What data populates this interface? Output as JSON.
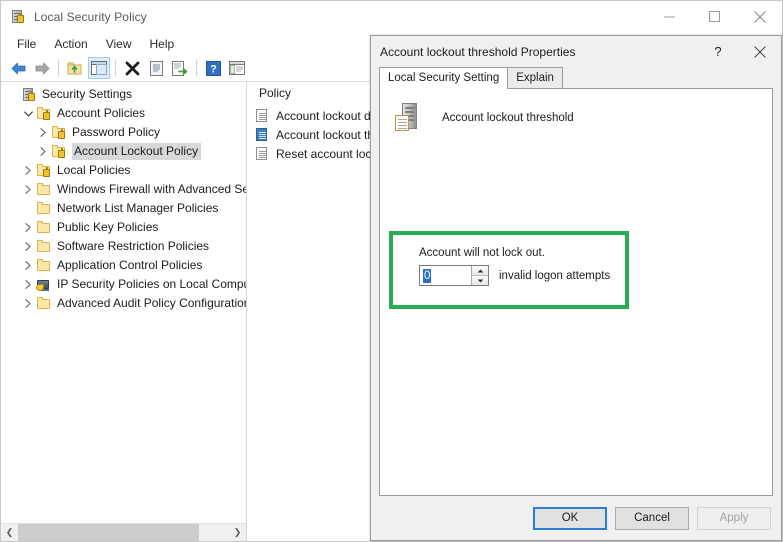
{
  "window": {
    "title": "Local Security Policy",
    "icon": "security-policy-icon",
    "controls": {
      "minimize": "–",
      "maximize": "□",
      "close": "✕"
    }
  },
  "menubar": {
    "items": [
      {
        "label": "File",
        "name": "menu-file"
      },
      {
        "label": "Action",
        "name": "menu-action"
      },
      {
        "label": "View",
        "name": "menu-view"
      },
      {
        "label": "Help",
        "name": "menu-help"
      }
    ]
  },
  "toolbar": {
    "buttons": [
      {
        "name": "back-icon",
        "glyph": "back"
      },
      {
        "name": "forward-icon",
        "glyph": "forward"
      },
      {
        "name": "up-one-level-icon",
        "glyph": "up"
      },
      {
        "name": "show-hide-tree-icon",
        "glyph": "tree",
        "active": true
      },
      {
        "name": "delete-icon",
        "glyph": "delete"
      },
      {
        "name": "properties-icon",
        "glyph": "properties"
      },
      {
        "name": "export-list-icon",
        "glyph": "export"
      },
      {
        "name": "help-icon",
        "glyph": "help"
      },
      {
        "name": "list-view-icon",
        "glyph": "listview"
      }
    ]
  },
  "tree": {
    "items": [
      {
        "label": "Security Settings",
        "indent": 0,
        "twisty": "",
        "icon": "server",
        "selected": false
      },
      {
        "label": "Account Policies",
        "indent": 1,
        "twisty": "expanded",
        "icon": "folder-lock",
        "selected": false
      },
      {
        "label": "Password Policy",
        "indent": 2,
        "twisty": "collapsed",
        "icon": "folder-lock",
        "selected": false
      },
      {
        "label": "Account Lockout Policy",
        "indent": 2,
        "twisty": "collapsed",
        "icon": "folder-lock",
        "selected": true
      },
      {
        "label": "Local Policies",
        "indent": 1,
        "twisty": "collapsed",
        "icon": "folder-lock",
        "selected": false
      },
      {
        "label": "Windows Firewall with Advanced Secu",
        "indent": 1,
        "twisty": "collapsed",
        "icon": "folder",
        "selected": false
      },
      {
        "label": "Network List Manager Policies",
        "indent": 1,
        "twisty": "",
        "icon": "folder",
        "selected": false
      },
      {
        "label": "Public Key Policies",
        "indent": 1,
        "twisty": "collapsed",
        "icon": "folder",
        "selected": false
      },
      {
        "label": "Software Restriction Policies",
        "indent": 1,
        "twisty": "collapsed",
        "icon": "folder",
        "selected": false
      },
      {
        "label": "Application Control Policies",
        "indent": 1,
        "twisty": "collapsed",
        "icon": "folder",
        "selected": false
      },
      {
        "label": "IP Security Policies on Local Compute",
        "indent": 1,
        "twisty": "collapsed",
        "icon": "ipsec",
        "selected": false
      },
      {
        "label": "Advanced Audit Policy Configuration",
        "indent": 1,
        "twisty": "collapsed",
        "icon": "folder",
        "selected": false
      }
    ],
    "scrollbar": {
      "left_arrow": "❮",
      "right_arrow": "❯"
    }
  },
  "list": {
    "header": "Policy",
    "rows": [
      {
        "label": "Account lockout d",
        "selected": false
      },
      {
        "label": "Account lockout th",
        "selected": true
      },
      {
        "label": "Reset account lock",
        "selected": false
      }
    ]
  },
  "dialog": {
    "title": "Account lockout threshold Properties",
    "help_button": "?",
    "close_button": "✕",
    "tabs": [
      {
        "label": "Local Security Setting",
        "active": true
      },
      {
        "label": "Explain",
        "active": false
      }
    ],
    "policy_name": "Account lockout threshold",
    "setting": {
      "description": "Account will not lock out.",
      "value": "0",
      "suffix": "invalid logon attempts",
      "spin_up": "▲",
      "spin_down": "▼",
      "highlight_color": "#2cab55"
    },
    "buttons": {
      "ok": "OK",
      "cancel": "Cancel",
      "apply": "Apply"
    }
  }
}
